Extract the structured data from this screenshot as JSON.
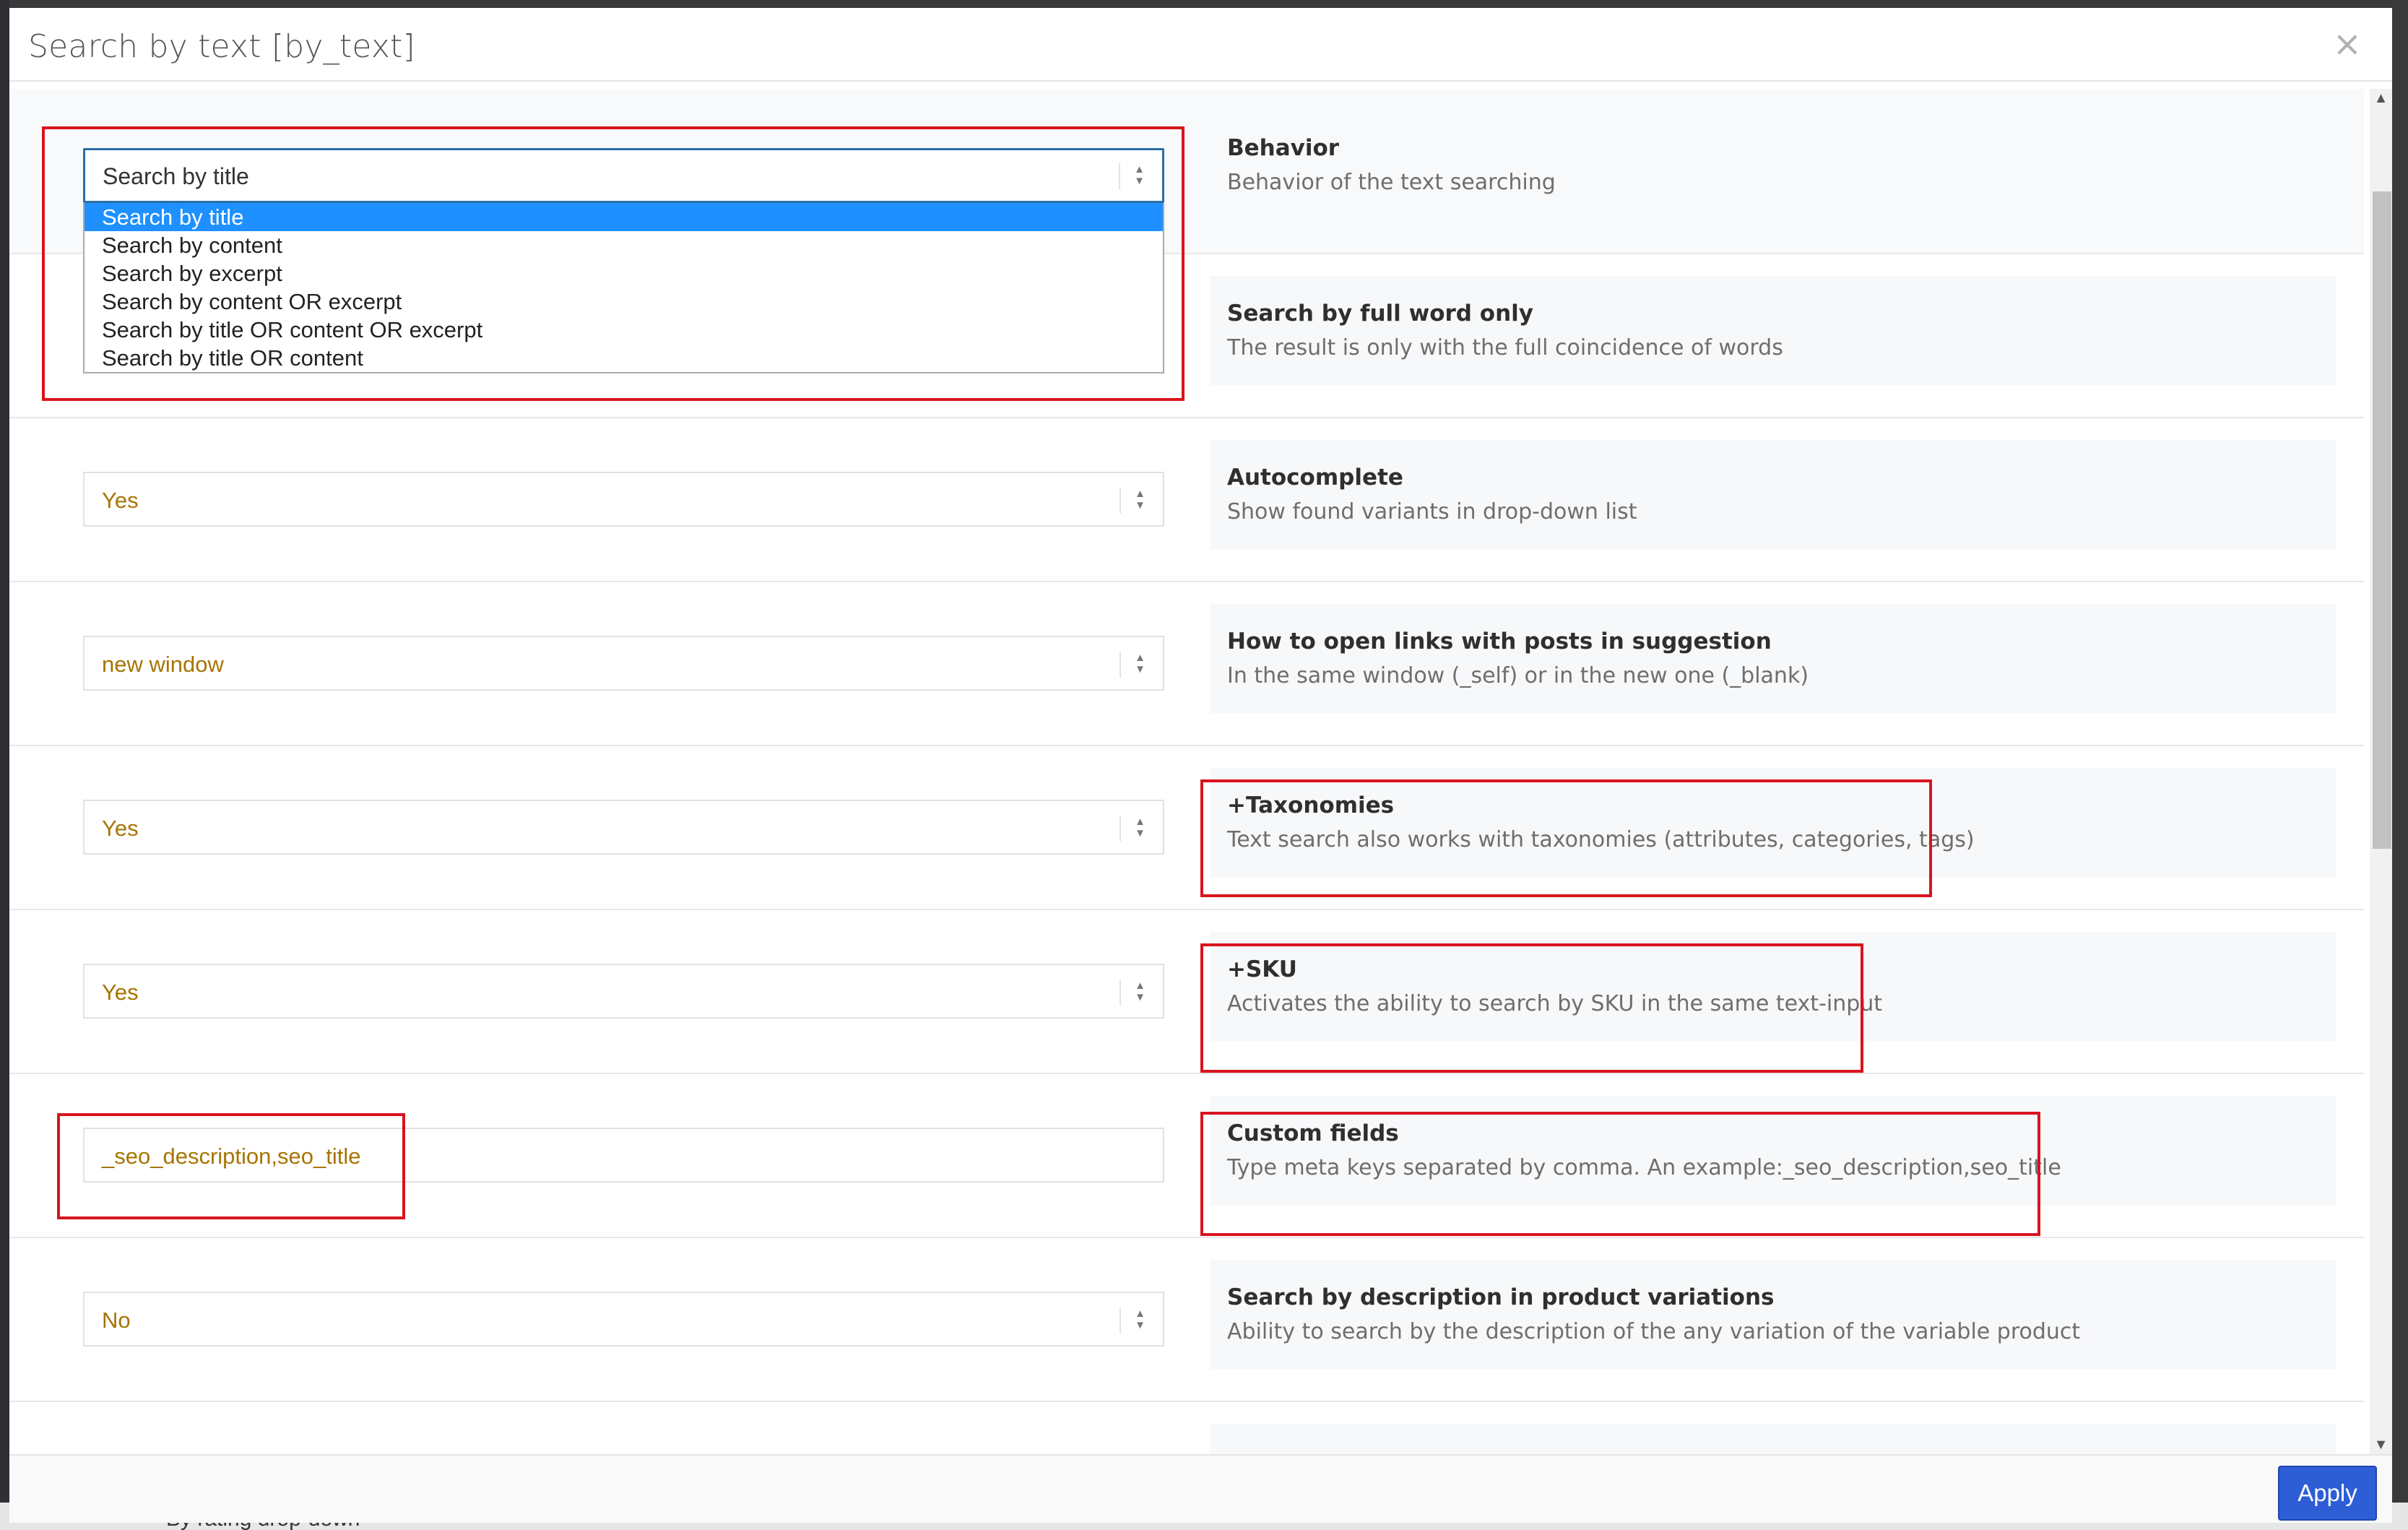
{
  "dialog": {
    "title": "Search by text [by_text]",
    "close_label": "×",
    "apply_label": "Apply"
  },
  "behavior": {
    "current_value": "Search by title",
    "options": [
      "Search by title",
      "Search by content",
      "Search by excerpt",
      "Search by content OR excerpt",
      "Search by title OR content OR excerpt",
      "Search by title OR content"
    ],
    "title": "Behavior",
    "description": "Behavior of the text searching"
  },
  "settings": [
    {
      "title": "Search by full word only",
      "description": "The result is only with the full coincidence of words",
      "value": ""
    },
    {
      "title": "Autocomplete",
      "description": "Show found variants in drop-down list",
      "value": "Yes"
    },
    {
      "title": "How to open links with posts in suggestion",
      "description": "In the same window (_self) or in the new one (_blank)",
      "value": "new window"
    },
    {
      "title": "+Taxonomies",
      "description": "Text search also works with taxonomies (attributes, categories, tags)",
      "value": "Yes"
    },
    {
      "title": "+SKU",
      "description": "Activates the ability to search by SKU in the same text-input",
      "value": "Yes"
    },
    {
      "title": "Custom fields",
      "description": "Type meta keys separated by comma. An example:_seo_description,seo_title",
      "value": "_seo_description,seo_title"
    },
    {
      "title": "Search by description in product variations",
      "description": "Ability to search by the description of the any variation of the variable product",
      "value": "No"
    }
  ],
  "background": {
    "partial_text": "By rating drop-down"
  },
  "colors": {
    "accent": "#2e5ed6",
    "highlight_border": "#d8141e",
    "selected_option": "#1e90ff",
    "value_text": "#a77400"
  }
}
